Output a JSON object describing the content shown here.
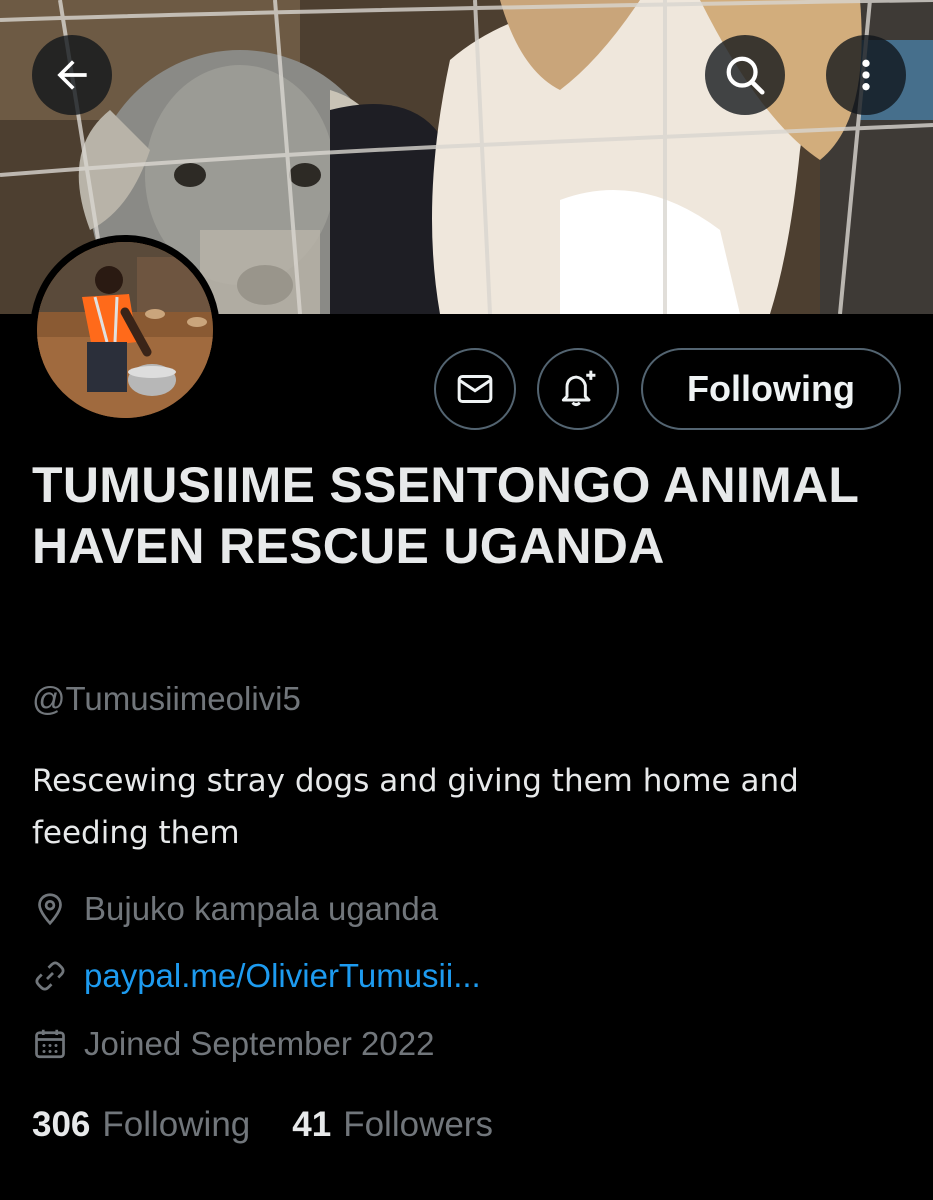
{
  "profile": {
    "display_name": "TUMUSIIME SSENTONGO ANIMAL HAVEN RESCUE UGANDA",
    "handle": "@Tumusiimeolivi5",
    "bio": "Rescewing stray dogs and giving them home and feeding them",
    "location": "Bujuko kampala uganda",
    "website": "paypal.me/OlivierTumusii...",
    "joined": "Joined September 2022"
  },
  "actions": {
    "follow_label": "Following"
  },
  "stats": {
    "following_count": "306",
    "following_label": "Following",
    "followers_count": "41",
    "followers_label": "Followers"
  },
  "icons": {
    "back": "arrow-left-icon",
    "search": "search-icon",
    "more": "more-vertical-icon",
    "message": "envelope-icon",
    "notify": "bell-plus-icon",
    "location": "location-pin-icon",
    "link": "link-icon",
    "joined": "calendar-icon"
  },
  "colors": {
    "background": "#000000",
    "text_primary": "#e7e9ea",
    "text_secondary": "#71767b",
    "link": "#1d9bf0",
    "border": "#536471"
  }
}
